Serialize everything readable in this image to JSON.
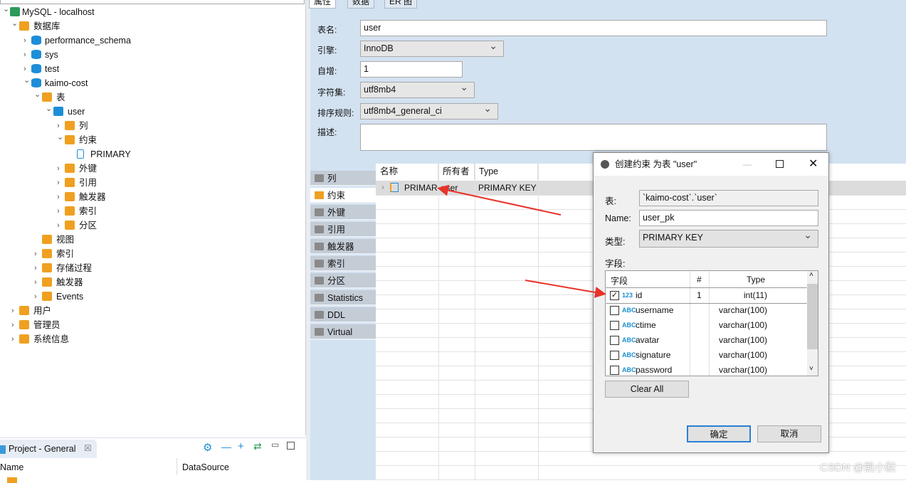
{
  "tree": [
    {
      "label": "MySQL - localhost",
      "level": 0,
      "chevron": "down",
      "icon": "connection-icon",
      "color": "#2e9a5a"
    },
    {
      "label": "数据库",
      "level": 1,
      "chevron": "down",
      "icon": "folder-icon",
      "color": "#f0a020"
    },
    {
      "label": "performance_schema",
      "level": 2,
      "chevron": "right",
      "icon": "database-icon",
      "color": "#1e8ed8"
    },
    {
      "label": "sys",
      "level": 2,
      "chevron": "right",
      "icon": "database-icon",
      "color": "#1e8ed8"
    },
    {
      "label": "test",
      "level": 2,
      "chevron": "right",
      "icon": "database-icon",
      "color": "#1e8ed8"
    },
    {
      "label": "kaimo-cost",
      "level": 2,
      "chevron": "down",
      "icon": "database-icon",
      "color": "#1e8ed8"
    },
    {
      "label": "表",
      "level": 3,
      "chevron": "down",
      "icon": "tables-folder-icon",
      "color": "#f0a020"
    },
    {
      "label": "user",
      "level": 4,
      "chevron": "down",
      "icon": "table-icon",
      "color": "#1e8ed8"
    },
    {
      "label": "列",
      "level": 5,
      "chevron": "right",
      "icon": "columns-folder-icon",
      "color": "#f0a020"
    },
    {
      "label": "约束",
      "level": 5,
      "chevron": "down",
      "icon": "constraints-folder-icon",
      "color": "#f0a020"
    },
    {
      "label": "PRIMARY",
      "level": 6,
      "chevron": "",
      "icon": "primary-key-icon",
      "color": "#1e8ed8"
    },
    {
      "label": "外键",
      "level": 5,
      "chevron": "right",
      "icon": "folder-icon",
      "color": "#f0a020"
    },
    {
      "label": "引用",
      "level": 5,
      "chevron": "right",
      "icon": "folder-icon",
      "color": "#f0a020"
    },
    {
      "label": "触发器",
      "level": 5,
      "chevron": "right",
      "icon": "folder-icon",
      "color": "#f0a020"
    },
    {
      "label": "索引",
      "level": 5,
      "chevron": "right",
      "icon": "folder-icon",
      "color": "#f0a020"
    },
    {
      "label": "分区",
      "level": 5,
      "chevron": "right",
      "icon": "folder-icon",
      "color": "#f0a020"
    },
    {
      "label": "视图",
      "level": 3,
      "chevron": "",
      "icon": "views-icon",
      "color": "#f0a020"
    },
    {
      "label": "索引",
      "level": 3,
      "chevron": "right",
      "icon": "folder-icon",
      "color": "#f0a020"
    },
    {
      "label": "存储过程",
      "level": 3,
      "chevron": "right",
      "icon": "folder-icon",
      "color": "#f0a020"
    },
    {
      "label": "触发器",
      "level": 3,
      "chevron": "right",
      "icon": "folder-icon",
      "color": "#f0a020"
    },
    {
      "label": "Events",
      "level": 3,
      "chevron": "right",
      "icon": "folder-icon",
      "color": "#f0a020"
    },
    {
      "label": "用户",
      "level": 1,
      "chevron": "right",
      "icon": "users-icon",
      "color": "#f0a020"
    },
    {
      "label": "管理员",
      "level": 1,
      "chevron": "right",
      "icon": "admin-icon",
      "color": "#f0a020"
    },
    {
      "label": "系统信息",
      "level": 1,
      "chevron": "right",
      "icon": "info-icon",
      "color": "#f0a020"
    }
  ],
  "editor": {
    "tabs": [
      "属性",
      "数据",
      "ER 图"
    ],
    "form": {
      "table_name_label": "表名:",
      "table_name": "user",
      "engine_label": "引擎:",
      "engine": "InnoDB",
      "auto_inc_label": "自增:",
      "auto_inc": "1",
      "charset_label": "字符集:",
      "charset": "utf8mb4",
      "collation_label": "排序规则:",
      "collation": "utf8mb4_general_ci",
      "desc_label": "描述:",
      "desc": ""
    },
    "side_tabs": [
      "列",
      "约束",
      "外键",
      "引用",
      "触发器",
      "索引",
      "分区",
      "Statistics",
      "DDL",
      "Virtual"
    ],
    "active_side_tab": "约束",
    "grid": {
      "headers": [
        "名称",
        "所有者",
        "Type"
      ],
      "rows": [
        [
          "PRIMAR",
          "user",
          "PRIMARY KEY"
        ]
      ]
    }
  },
  "dialog": {
    "title": "创建约束 为表 \"user\"",
    "table_label": "表:",
    "table_value": "`kaimo-cost`.`user`",
    "name_label": "Name:",
    "name_value": "user_pk",
    "type_label": "类型:",
    "type_value": "PRIMARY KEY",
    "fields_label": "字段:",
    "columns": [
      "字段",
      "#",
      "Type"
    ],
    "fields": [
      {
        "name": "id",
        "num": "1",
        "type": "int(11)",
        "checked": true,
        "icon": "123"
      },
      {
        "name": "username",
        "num": "",
        "type": "varchar(100)",
        "checked": false,
        "icon": "ABC"
      },
      {
        "name": "ctime",
        "num": "",
        "type": "varchar(100)",
        "checked": false,
        "icon": "ABC"
      },
      {
        "name": "avatar",
        "num": "",
        "type": "varchar(100)",
        "checked": false,
        "icon": "ABC"
      },
      {
        "name": "signature",
        "num": "",
        "type": "varchar(100)",
        "checked": false,
        "icon": "ABC"
      },
      {
        "name": "password",
        "num": "",
        "type": "varchar(100)",
        "checked": false,
        "icon": "ABC"
      }
    ],
    "clear_all": "Clear All",
    "ok": "确定",
    "cancel": "取消"
  },
  "project": {
    "tab": "Project - General",
    "col_name": "Name",
    "col_datasource": "DataSource"
  },
  "watermark": "CSDN @凯小默",
  "colors": {
    "accent": "#1e8ed8",
    "folder": "#f0a020",
    "arrow": "#e8332a",
    "panel": "#d3e2f1"
  }
}
